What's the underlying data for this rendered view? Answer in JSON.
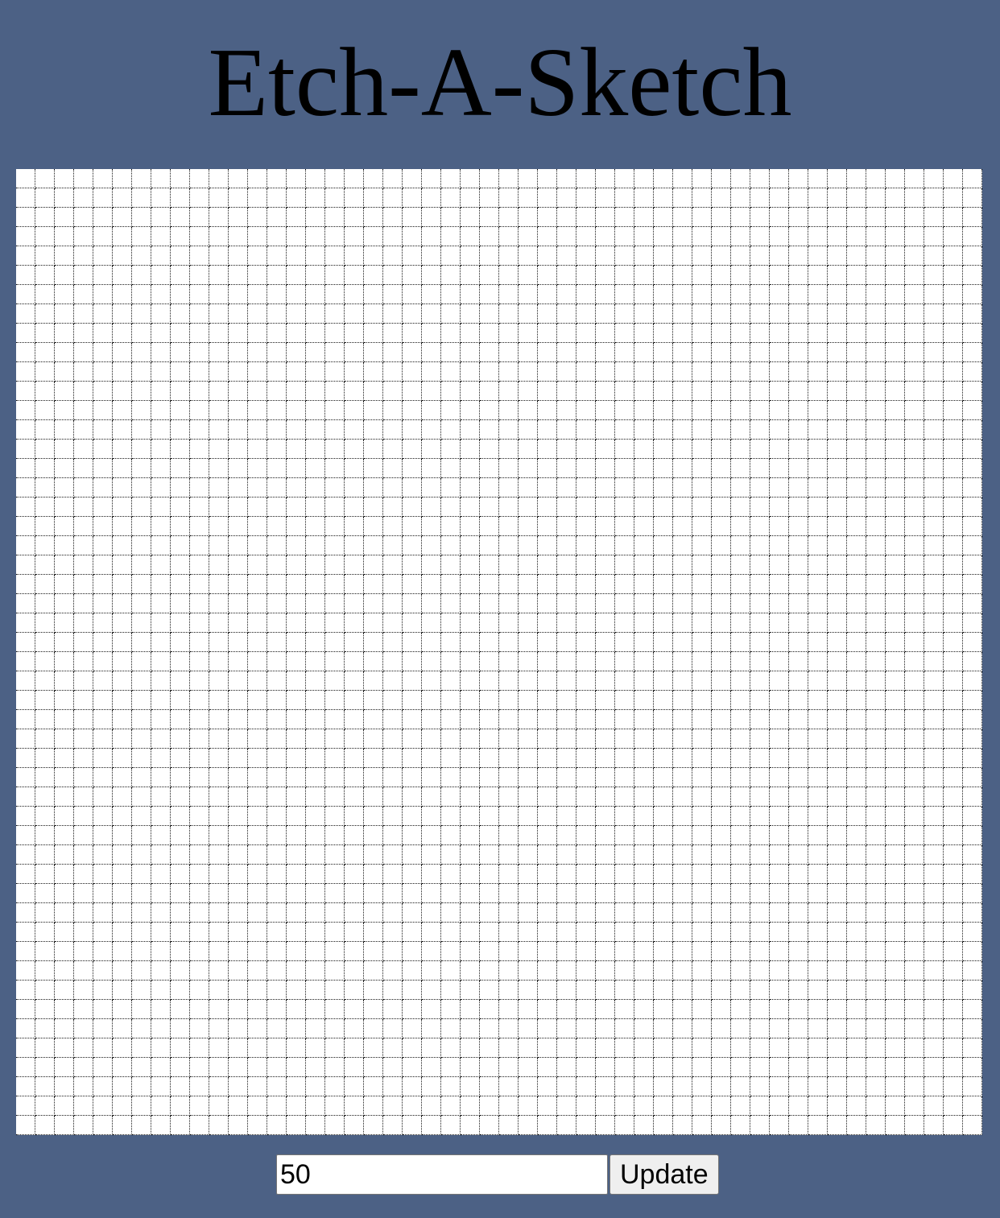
{
  "page": {
    "title": "Etch-A-Sketch",
    "background_color": "#4c6185"
  },
  "grid": {
    "columns": 50,
    "rows": 50,
    "cell_color": "#ffffff",
    "line_color": "#1a1a1a"
  },
  "controls": {
    "size_value": "50",
    "update_label": "Update"
  }
}
